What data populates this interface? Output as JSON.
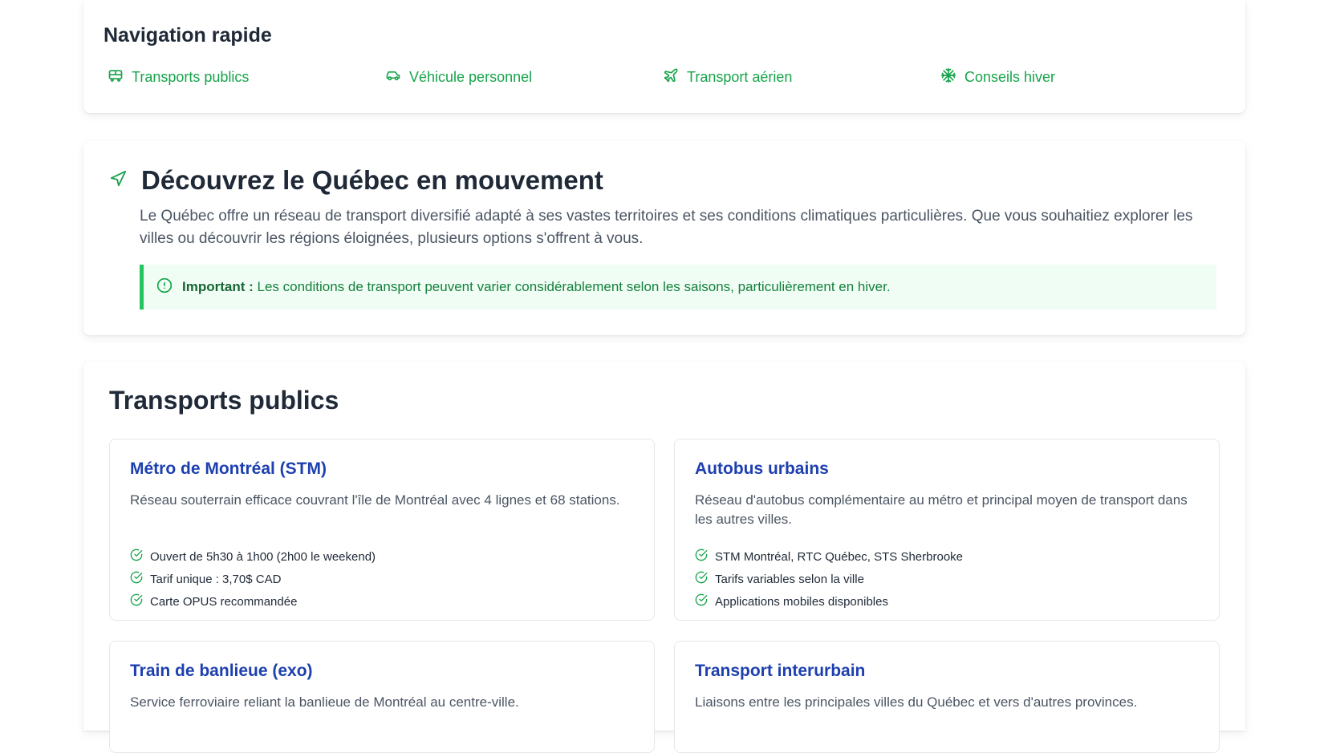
{
  "quick_nav": {
    "title": "Navigation rapide",
    "links": [
      {
        "label": "Transports publics",
        "icon": "bus-icon"
      },
      {
        "label": "Véhicule personnel",
        "icon": "car-icon"
      },
      {
        "label": "Transport aérien",
        "icon": "plane-icon"
      },
      {
        "label": "Conseils hiver",
        "icon": "snowflake-icon"
      }
    ]
  },
  "intro": {
    "title": "Découvrez le Québec en mouvement",
    "icon": "navigation-arrow-icon",
    "description": "Le Québec offre un réseau de transport diversifié adapté à ses vastes territoires et ses conditions climatiques particulières. Que vous souhaitiez explorer les villes ou découvrir les régions éloignées, plusieurs options s'offrent à vous.",
    "alert": {
      "label": "Important :",
      "text": " Les conditions de transport peuvent varier considérablement selon les saisons, particulièrement en hiver.",
      "icon": "alert-circle-icon"
    }
  },
  "public_transport": {
    "title": "Transports publics",
    "cards": [
      {
        "title": "Métro de Montréal (STM)",
        "description": "Réseau souterrain efficace couvrant l'île de Montréal avec 4 lignes et 68 stations.",
        "features": [
          "Ouvert de 5h30 à 1h00 (2h00 le weekend)",
          "Tarif unique : 3,70$ CAD",
          "Carte OPUS recommandée"
        ]
      },
      {
        "title": "Autobus urbains",
        "description": "Réseau d'autobus complémentaire au métro et principal moyen de transport dans les autres villes.",
        "features": [
          "STM Montréal, RTC Québec, STS Sherbrooke",
          "Tarifs variables selon la ville",
          "Applications mobiles disponibles"
        ]
      },
      {
        "title": "Train de banlieue (exo)",
        "description": "Service ferroviaire reliant la banlieue de Montréal au centre-ville.",
        "features": []
      },
      {
        "title": "Transport interurbain",
        "description": "Liaisons entre les principales villes du Québec et vers d'autres provinces.",
        "features": []
      }
    ]
  },
  "colors": {
    "accent_green": "#16a34a",
    "card_title_blue": "#1e40af",
    "alert_bg": "#f0fdf4"
  }
}
